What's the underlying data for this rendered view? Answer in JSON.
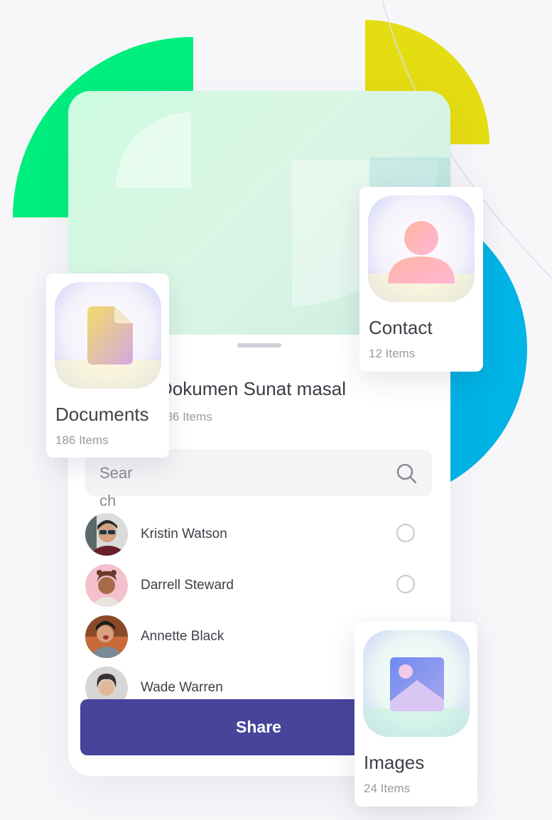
{
  "folder": {
    "title": "Dokumen Sunat masal",
    "count": "186 Items"
  },
  "search": {
    "placeholder": "Search"
  },
  "contacts": [
    {
      "name": "Kristin Watson",
      "avatar": "avatar-kristin-watson",
      "selectable": true
    },
    {
      "name": "Darrell Steward",
      "avatar": "avatar-darrell-steward",
      "selectable": true
    },
    {
      "name": "Annette Black",
      "avatar": "avatar-annette-black",
      "selectable": false
    },
    {
      "name": "Wade Warren",
      "avatar": "avatar-wade-warren",
      "selectable": false
    }
  ],
  "share_button": {
    "label": "Share"
  },
  "cards": {
    "contact": {
      "name": "Contact",
      "count": "12 Items",
      "icon": "person-icon"
    },
    "documents": {
      "name": "Documents",
      "count": "186 Items",
      "icon": "document-icon"
    },
    "images": {
      "name": "Images",
      "count": "24 Items",
      "icon": "image-icon"
    }
  },
  "colors": {
    "accent": "#46459a",
    "green_shape": "#00ee7e",
    "yellow_shape": "#e4dd12",
    "blue_shape": "#00b4e6"
  }
}
